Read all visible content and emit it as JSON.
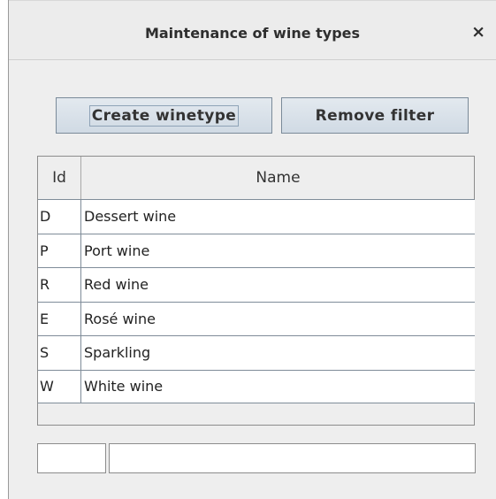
{
  "window": {
    "title": "Maintenance of wine types",
    "close_symbol": "×"
  },
  "toolbar": {
    "create_label": "Create winetype",
    "remove_filter_label": "Remove filter"
  },
  "table": {
    "columns": [
      "Id",
      "Name"
    ],
    "rows": [
      {
        "id": "D",
        "name": "Dessert wine"
      },
      {
        "id": "P",
        "name": "Port wine"
      },
      {
        "id": "R",
        "name": "Red wine"
      },
      {
        "id": "E",
        "name": "Rosé wine"
      },
      {
        "id": "S",
        "name": "Sparkling"
      },
      {
        "id": "W",
        "name": "White wine"
      }
    ]
  },
  "status": {
    "left_value": "",
    "right_value": ""
  },
  "colors": {
    "window_bg": "#eeeeee",
    "button_border": "#7a8a99",
    "grid_line": "#7f8c99"
  }
}
